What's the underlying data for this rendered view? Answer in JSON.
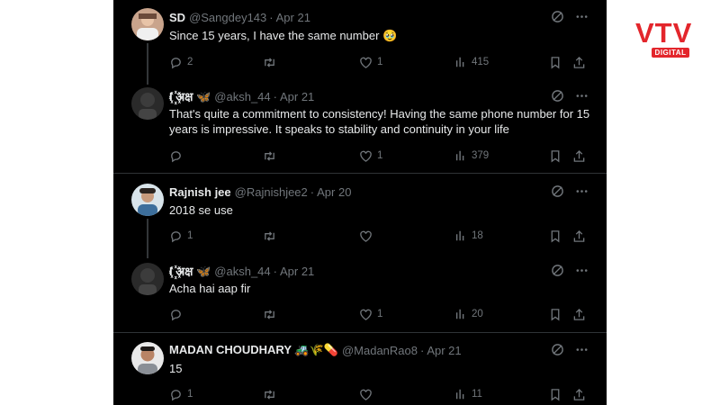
{
  "brand": {
    "logo_main": "VTV",
    "logo_sub": "DIGITAL"
  },
  "tweets": [
    {
      "name": "SD",
      "handle": "@Sangdey143",
      "sep": "·",
      "date": "Apr 21",
      "text": "Since 15 years, I have the same number 🥹",
      "replies": "2",
      "reposts": "",
      "likes": "1",
      "views": "415"
    },
    {
      "name": "I ꙰अक्ष 🦋",
      "handle": "@aksh_44",
      "sep": "·",
      "date": "Apr 21",
      "text": "That's quite a commitment to consistency! Having the same phone number for 15 years is impressive. It speaks to stability and continuity in your life",
      "replies": "",
      "reposts": "",
      "likes": "1",
      "views": "379"
    },
    {
      "name": "Rajnish jee",
      "handle": "@Rajnishjee2",
      "sep": "·",
      "date": "Apr 20",
      "text": "2018 se use",
      "replies": "1",
      "reposts": "",
      "likes": "",
      "views": "18"
    },
    {
      "name": "I ꙰अक्ष 🦋",
      "handle": "@aksh_44",
      "sep": "·",
      "date": "Apr 21",
      "text": "Acha hai aap fir",
      "replies": "",
      "reposts": "",
      "likes": "1",
      "views": "20"
    },
    {
      "name": "MADAN CHOUDHARY 🚜🌾💊",
      "handle": "@MadanRao8",
      "sep": "·",
      "date": "Apr 21",
      "text": "15",
      "replies": "1",
      "reposts": "",
      "likes": "",
      "views": "11"
    }
  ]
}
